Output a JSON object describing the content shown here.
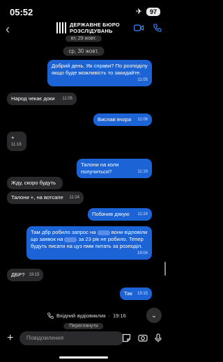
{
  "status": {
    "time": "05:52",
    "battery": "97"
  },
  "header": {
    "title_line1": "ДЕРЖАВНЕ БЮРО",
    "title_line2": "РОЗСЛІДУВАНЬ"
  },
  "dates": {
    "top_partial": "вт, 29 жовт.",
    "wed": "ср, 30 жовт.",
    "bottom_partial": "Переглянути"
  },
  "messages": [
    {
      "dir": "out",
      "text": "Добрий день. Як справи? По розподілу якщо буде можливість то закидайте.",
      "time": "11:05"
    },
    {
      "dir": "in",
      "text": "Народ чекає доки",
      "time": "11:05"
    },
    {
      "dir": "out",
      "text": "Вислав вчора",
      "time": "11:06"
    },
    {
      "dir": "in",
      "text": "+",
      "time": "11:18"
    },
    {
      "dir": "out",
      "text": "Талони на коли получиться?",
      "time": "11:19"
    },
    {
      "dir": "in",
      "text": "Жду, скоро будуть",
      "time": ""
    },
    {
      "dir": "in",
      "text": "Талони +, на вотсапе",
      "time": "11:24"
    },
    {
      "dir": "out",
      "text": "Побачив дякую",
      "time": "11:24"
    },
    {
      "dir": "out",
      "text_a": "Там дбр робило запрос на",
      "text_b": "вони відповіли що заявок на",
      "text_c": "за 23 рік не робило. Тепер будуть писати на цуз пмм питать за розподіл.",
      "time": "19:04"
    },
    {
      "dir": "in",
      "text": "ДБР?",
      "time": "19:15"
    },
    {
      "dir": "out",
      "text": "Так",
      "time": "19:15"
    }
  ],
  "call": {
    "label": "Вхідний аудіовиклик",
    "time": "19:16",
    "separator": "·"
  },
  "composer": {
    "placeholder": "Повідомлення"
  },
  "colors": {
    "outgoing": "#1c63d6",
    "incoming": "#2a2a2c",
    "background": "#000000"
  }
}
